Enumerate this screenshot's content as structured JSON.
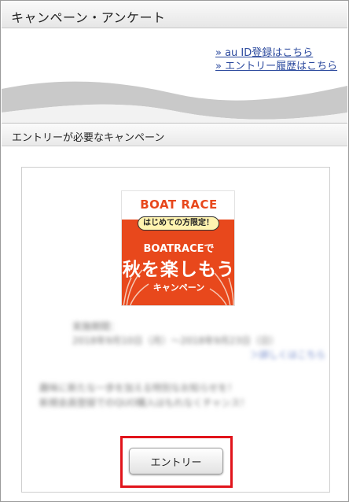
{
  "header": {
    "title": "キャンペーン・アンケート"
  },
  "links": [
    {
      "label": "» au ID登録はこちら"
    },
    {
      "label": "» エントリー履歴はこちら"
    }
  ],
  "section": {
    "title": "エントリーが必要なキャンペーン"
  },
  "campaign": {
    "banner": {
      "brand": "BOAT RACE",
      "badge": "はじめての方限定！",
      "line1": "BOATRACEで",
      "line2": "秋を楽しもう",
      "line3": "キャンペーン",
      "bg_color": "#e8481c",
      "badge_color": "#fff3b0"
    },
    "blurred": {
      "period_label": "実施期間：",
      "period_value": "2018年9月10日（月）～2018年9月23日（日）",
      "detail_link": "＞詳しくはこちら",
      "desc_line1": "趣味に新たな一歩を加える特別なお知らせを！",
      "desc_line2": "新規会員登録でのQUO購入はもれなくチャンス！"
    },
    "entry_button": "エントリー",
    "highlight_color": "#e1141b"
  },
  "colors": {
    "link": "#2c4a9e",
    "accent": "#e1141b"
  }
}
